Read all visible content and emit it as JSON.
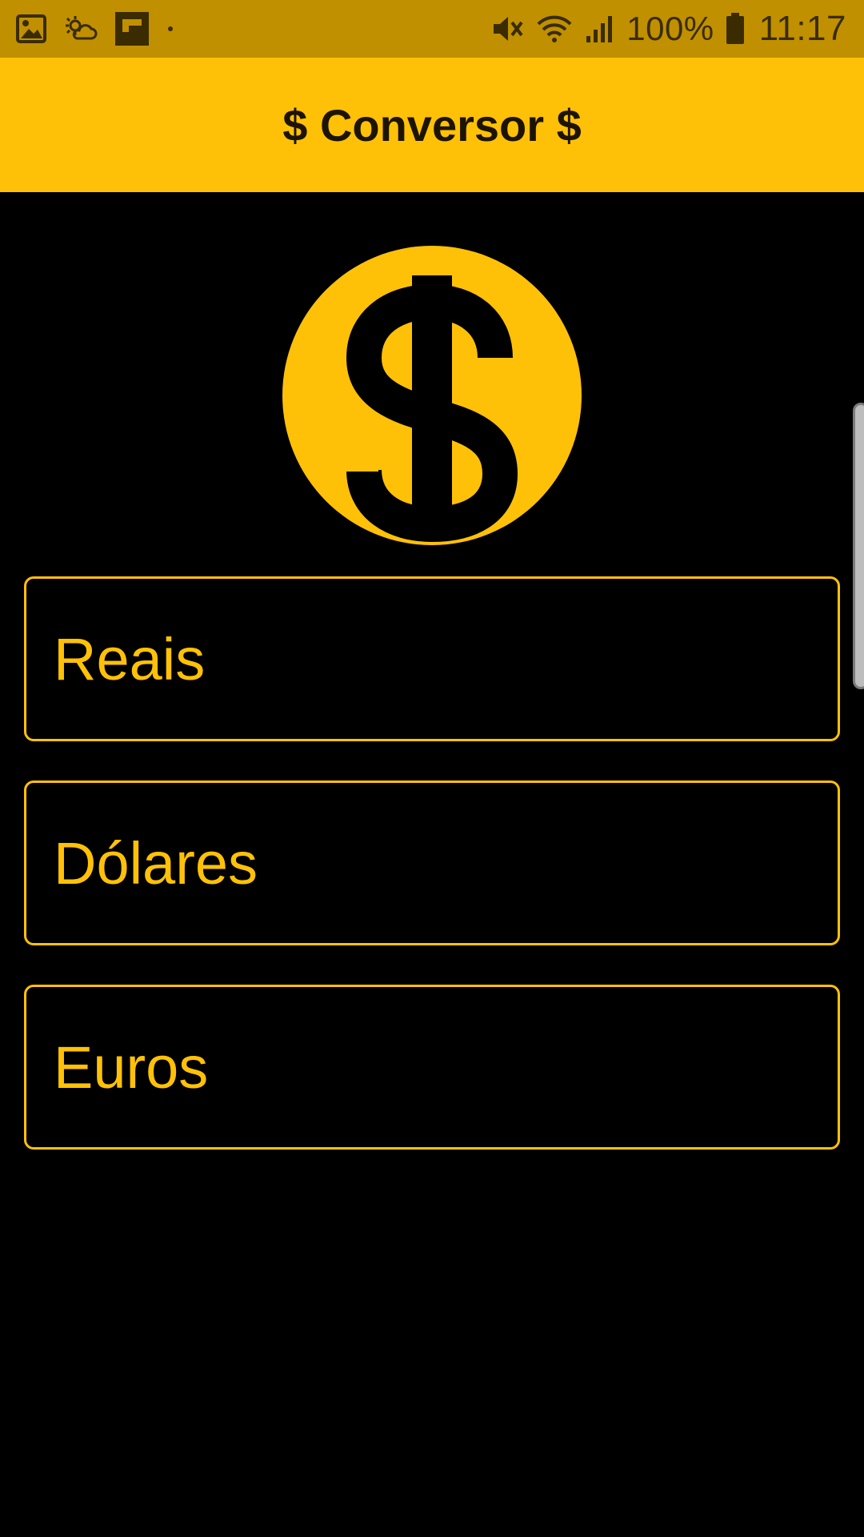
{
  "status_bar": {
    "battery_text": "100%",
    "time": "11:17",
    "icons": [
      "gallery-icon",
      "weather-icon",
      "flipboard-icon",
      "dot-icon",
      "mute-icon",
      "wifi-icon",
      "signal-icon",
      "battery-icon"
    ]
  },
  "app_bar": {
    "title": "$ Conversor $"
  },
  "logo": {
    "icon": "dollar-coin-icon"
  },
  "fields": {
    "reais": {
      "placeholder": "Reais"
    },
    "dolares": {
      "placeholder": "Dólares"
    },
    "euros": {
      "placeholder": "Euros"
    }
  },
  "colors": {
    "status_bar": "#C09000",
    "accent": "#FFC107",
    "background": "#000000",
    "title_text": "#1D1400"
  }
}
